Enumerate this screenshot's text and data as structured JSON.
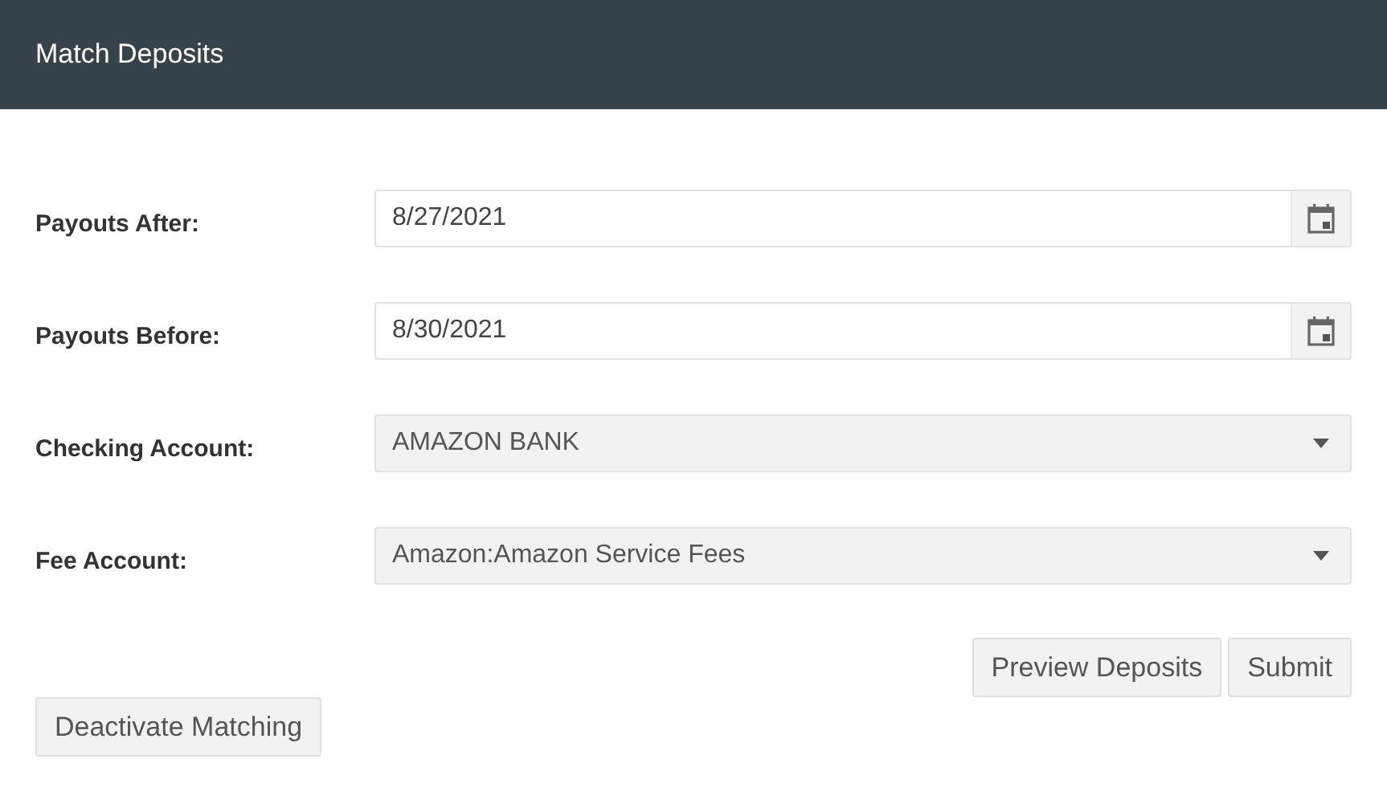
{
  "header": {
    "title": "Match Deposits"
  },
  "fields": [
    {
      "label": "Payouts After:",
      "kind": "date",
      "value": "8/27/2021"
    },
    {
      "label": "Payouts Before:",
      "kind": "date",
      "value": "8/30/2021"
    },
    {
      "label": "Checking Account:",
      "kind": "select",
      "value": "AMAZON BANK"
    },
    {
      "label": "Fee Account:",
      "kind": "select",
      "value": "Amazon:Amazon Service Fees"
    }
  ],
  "actions": [
    "Preview Deposits",
    "Submit"
  ],
  "secondary_action": "Deactivate Matching"
}
